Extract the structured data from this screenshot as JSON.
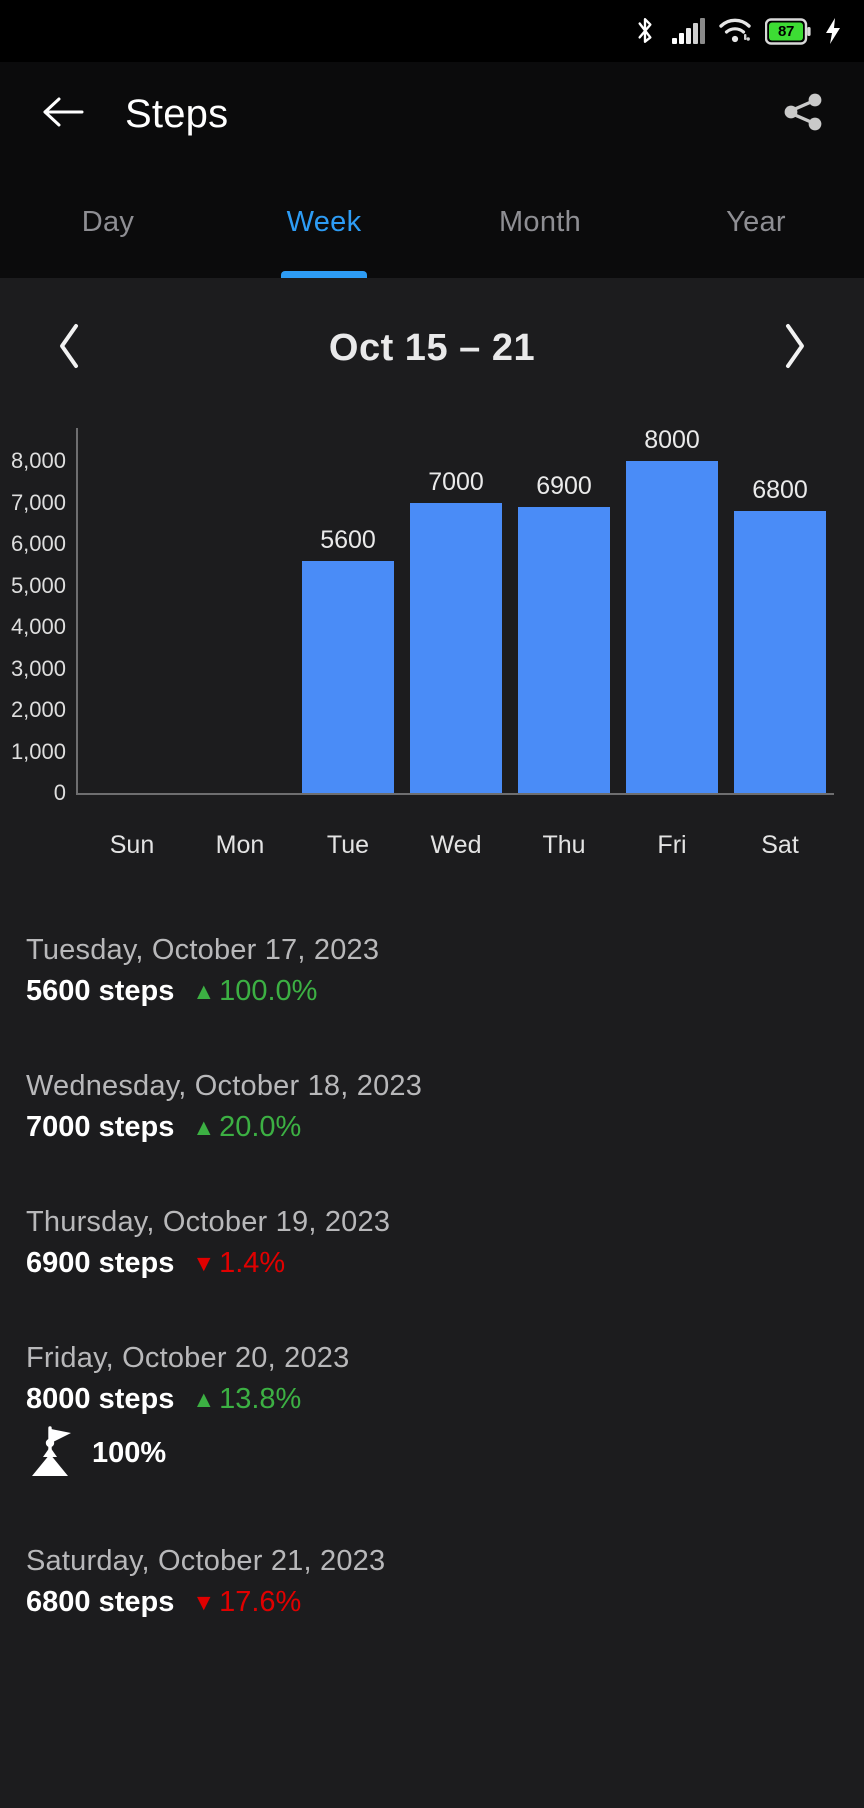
{
  "status_bar": {
    "icons": [
      "bluetooth-icon",
      "cellular-signal-icon",
      "wifi-icon",
      "battery-icon",
      "charging-bolt-icon"
    ],
    "battery_percent": "87",
    "battery_color": "#3ddc34"
  },
  "app_bar": {
    "back_icon": "back-arrow-icon",
    "title": "Steps",
    "share_icon": "share-icon"
  },
  "tabs": {
    "items": [
      {
        "label": "Day",
        "active": false
      },
      {
        "label": "Week",
        "active": true
      },
      {
        "label": "Month",
        "active": false
      },
      {
        "label": "Year",
        "active": false
      }
    ],
    "accent_color": "#2d9cf5",
    "inactive_color": "#8e8e93"
  },
  "date_nav": {
    "prev_icon": "chevron-left-icon",
    "label": "Oct 15 – 21",
    "next_icon": "chevron-right-icon"
  },
  "chart_data": {
    "type": "bar",
    "title": "",
    "xlabel": "",
    "ylabel": "",
    "categories": [
      "Sun",
      "Mon",
      "Tue",
      "Wed",
      "Thu",
      "Fri",
      "Sat"
    ],
    "values": [
      0,
      0,
      5600,
      7000,
      6900,
      8000,
      6800
    ],
    "value_labels": [
      "",
      "",
      "5600",
      "7000",
      "6900",
      "8000",
      "6800"
    ],
    "ylim": [
      0,
      8800
    ],
    "yticks": [
      0,
      1000,
      2000,
      3000,
      4000,
      5000,
      6000,
      7000,
      8000
    ],
    "ytick_labels": [
      "0",
      "1,000",
      "2,000",
      "3,000",
      "4,000",
      "5,000",
      "6,000",
      "7,000",
      "8,000"
    ],
    "grid": false,
    "legend": false,
    "bar_color": "#4a8cf7",
    "axis_color": "#6e6e70",
    "text_color": "#e3e3e3"
  },
  "entries": [
    {
      "date": "Tuesday, October 17, 2023",
      "steps": "5600 steps",
      "delta": "100.0%",
      "direction": "up",
      "arrow": "▲",
      "goal": null
    },
    {
      "date": "Wednesday, October 18, 2023",
      "steps": "7000 steps",
      "delta": "20.0%",
      "direction": "up",
      "arrow": "▲",
      "goal": null
    },
    {
      "date": "Thursday, October 19, 2023",
      "steps": "6900 steps",
      "delta": "1.4%",
      "direction": "down",
      "arrow": "▼",
      "goal": null
    },
    {
      "date": "Friday, October 20, 2023",
      "steps": "8000 steps",
      "delta": "13.8%",
      "direction": "up",
      "arrow": "▲",
      "goal": {
        "icon": "goal-flag-summit-icon",
        "percent": "100%"
      }
    },
    {
      "date": "Saturday, October 21, 2023",
      "steps": "6800 steps",
      "delta": "17.6%",
      "direction": "down",
      "arrow": "▼",
      "goal": null
    }
  ],
  "colors": {
    "background": "#1c1c1e",
    "app_bar_background": "#0b0b0c",
    "status_bar_background": "#000000",
    "up_color": "#3cb043",
    "down_color": "#e00000",
    "primary_text": "#ffffff",
    "secondary_text": "#b8b8ba"
  }
}
